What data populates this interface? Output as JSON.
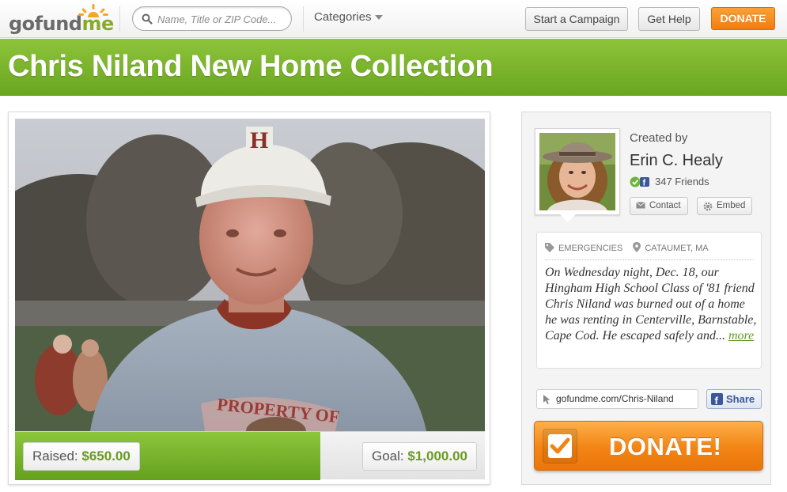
{
  "header": {
    "logo": {
      "go": "go",
      "fund": "fund",
      "me": "me"
    },
    "search_placeholder": "Name, Title or ZIP Code...",
    "categories_label": "Categories",
    "start_campaign_label": "Start a Campaign",
    "get_help_label": "Get Help",
    "donate_label": "DONATE"
  },
  "campaign": {
    "title": "Chris Niland New Home Collection",
    "raised_label": "Raised:",
    "raised_amount": "$650.00",
    "goal_label": "Goal:",
    "goal_amount": "$1,000.00",
    "progress_fraction": 0.65
  },
  "sidebar": {
    "created_by_label": "Created by",
    "creator_name": "Erin C. Healy",
    "friends": "347 Friends",
    "contact_label": "Contact",
    "embed_label": "Embed",
    "category": "EMERGENCIES",
    "location": "CATAUMET, MA",
    "story": "On Wednesday night, Dec. 18, our Hingham High School Class of '81 friend Chris Niland was burned out of a home he was renting in Centerville, Barnstable, Cape Cod. He escaped safely and...",
    "more_label": "more",
    "short_url": "gofundme.com/Chris-Niland",
    "share_label": "Share",
    "donate_big_label": "DONATE!"
  },
  "colors": {
    "brand_green": "#7ab32e",
    "donate_orange": "#f28414",
    "facebook_blue": "#3b5998"
  }
}
